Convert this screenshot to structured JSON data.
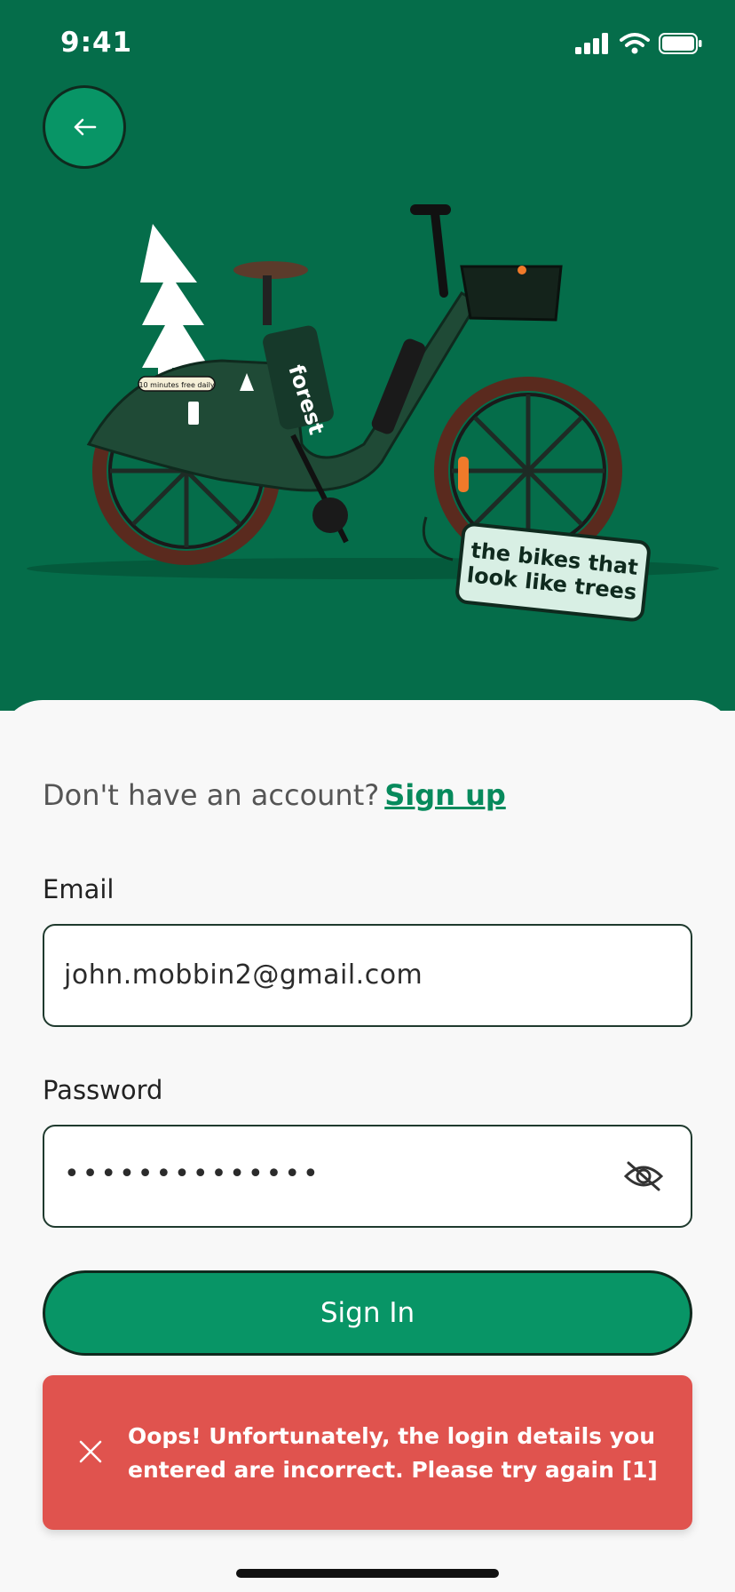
{
  "status_bar": {
    "time": "9:41"
  },
  "hero": {
    "bike_brand": "forest",
    "bike_badge": "10 minutes free daily",
    "tagline": "the bikes that look like trees"
  },
  "signup": {
    "prompt": "Don't have an account?",
    "link": "Sign up"
  },
  "form": {
    "email_label": "Email",
    "email_value": "john.mobbin2@gmail.com",
    "password_label": "Password",
    "password_masked": "••••••••••••••",
    "signin_label": "Sign In"
  },
  "toast": {
    "message": "Oops! Unfortunately, the login details you entered are incorrect. Please try again [1]"
  },
  "colors": {
    "hero_bg": "#056d4a",
    "primary": "#089566",
    "link": "#078a5c",
    "error": "#e0534e",
    "outline": "#0f2a1e"
  },
  "icons": {
    "back": "arrow-left-icon",
    "password_toggle": "eye-off-icon",
    "close": "close-icon"
  }
}
